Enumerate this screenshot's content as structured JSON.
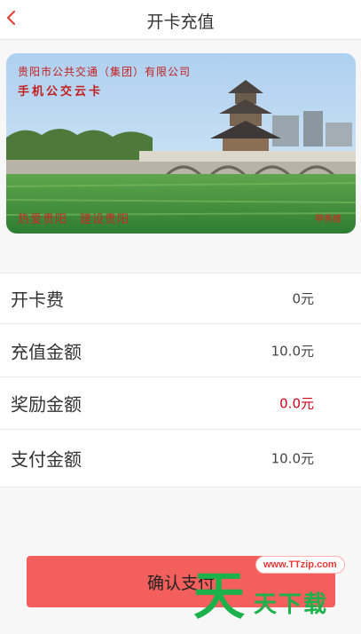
{
  "header": {
    "title": "开卡充值",
    "back_icon": "chevron-left-icon",
    "accent": "#e0473f"
  },
  "card": {
    "company": "贵阳市公共交通（集团）有限公司",
    "name": "手机公交云卡",
    "slogan": "热爱贵阳　建设贵阳",
    "seal": "甲秀楼"
  },
  "fees": [
    {
      "label": "开卡费",
      "value": "0元",
      "color": "#444444"
    },
    {
      "label": "充值金额",
      "value": "10.0元",
      "color": "#444444"
    },
    {
      "label": "奖励金额",
      "value": "0.0元",
      "color": "#d0021b"
    },
    {
      "label": "支付金额",
      "value": "10.0元",
      "color": "#444444"
    }
  ],
  "confirm_button": {
    "label": "确认支付",
    "color": "#f25f5c"
  },
  "watermark": {
    "url": "www.TTzip.com",
    "big_char": "天",
    "text": "天下载"
  }
}
